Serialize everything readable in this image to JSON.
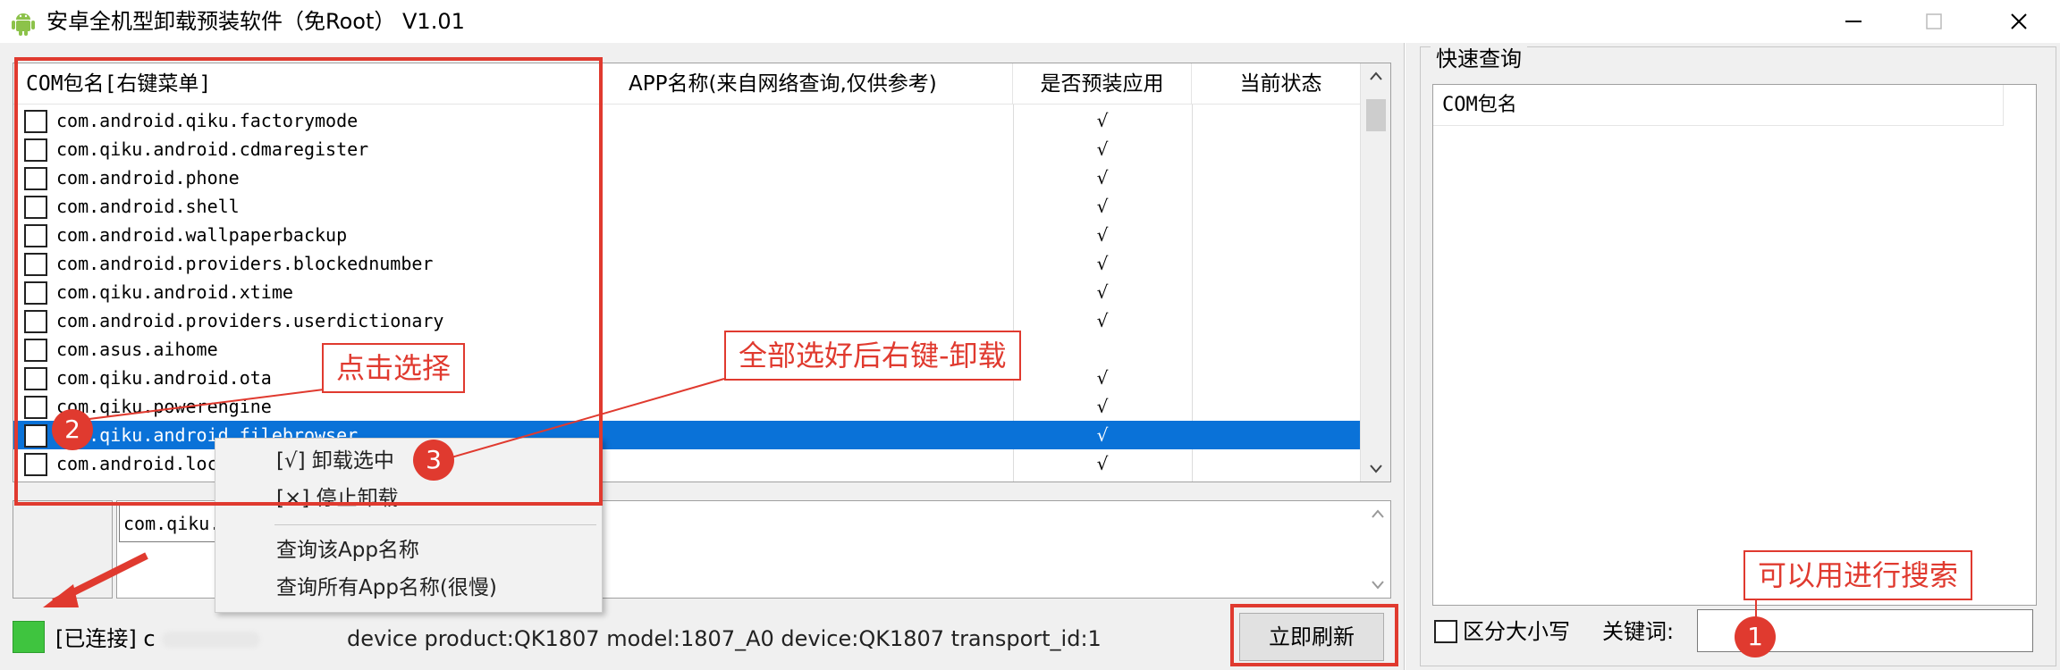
{
  "window": {
    "title": "安卓全机型卸载预装软件（免Root） V1.01"
  },
  "list": {
    "columns": [
      "COM包名[右键菜单]",
      "APP名称(来自网络查询,仅供参考)",
      "是否预装应用",
      "当前状态"
    ],
    "rows": [
      {
        "pkg": "com.android.qiku.factorymode",
        "preinstalled": "√"
      },
      {
        "pkg": "com.qiku.android.cdmaregister",
        "preinstalled": "√"
      },
      {
        "pkg": "com.android.phone",
        "preinstalled": "√"
      },
      {
        "pkg": "com.android.shell",
        "preinstalled": "√"
      },
      {
        "pkg": "com.android.wallpaperbackup",
        "preinstalled": "√"
      },
      {
        "pkg": "com.android.providers.blockednumber",
        "preinstalled": "√"
      },
      {
        "pkg": "com.qiku.android.xtime",
        "preinstalled": "√"
      },
      {
        "pkg": "com.android.providers.userdictionary",
        "preinstalled": "√"
      },
      {
        "pkg": "com.asus.aihome",
        "preinstalled": ""
      },
      {
        "pkg": "com.qiku.android.ota",
        "preinstalled": "√"
      },
      {
        "pkg": "com.qiku.powerengine",
        "preinstalled": "√"
      },
      {
        "pkg": "com.qiku.android.filebrowser",
        "preinstalled": "√"
      },
      {
        "pkg": "com.android.loc",
        "preinstalled": "√"
      }
    ]
  },
  "detail_input": {
    "value": "com.qiku."
  },
  "context_menu": {
    "items": [
      "[√] 卸载选中",
      "[×] 停止卸载",
      "查询该App名称",
      "查询所有App名称(很慢)"
    ]
  },
  "status": {
    "connected": "[已连接] c",
    "device": "device product:QK1807 model:1807_A0 device:QK1807 transport_id:1",
    "refresh_button": "立即刷新"
  },
  "quick_query": {
    "title": "快速查询",
    "column": "COM包名",
    "case_sensitive_label": "区分大小写",
    "keyword_label": "关键词:"
  },
  "annotations": {
    "click_select": "点击选择",
    "right_click_uninstall": "全部选好后右键-卸载",
    "search_hint": "可以用进行搜索",
    "badge1": "1",
    "badge2": "2",
    "badge3": "3",
    "accent": "#e03a2f"
  }
}
